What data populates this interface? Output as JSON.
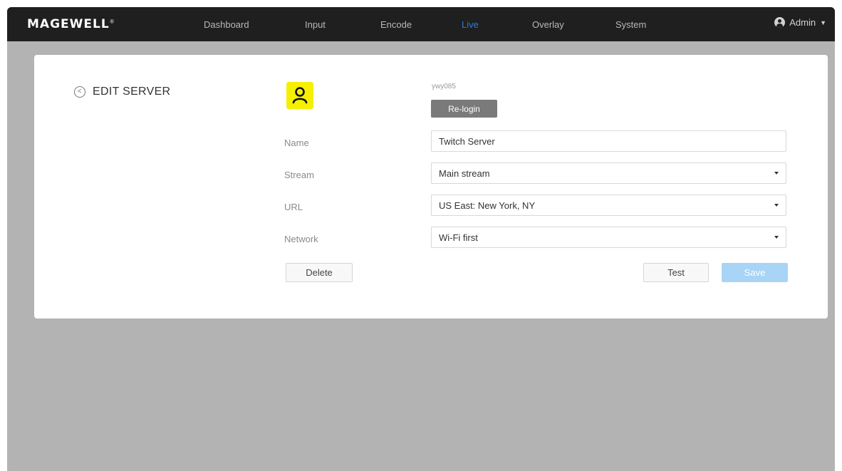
{
  "brand": {
    "logo_text": "MAGEWELL",
    "trademark": "®"
  },
  "nav": {
    "items": [
      {
        "label": "Dashboard",
        "active": false
      },
      {
        "label": "Input",
        "active": false
      },
      {
        "label": "Encode",
        "active": false
      },
      {
        "label": "Live",
        "active": true
      },
      {
        "label": "Overlay",
        "active": false
      },
      {
        "label": "System",
        "active": false
      }
    ],
    "user": {
      "label": "Admin",
      "icon": "user-icon"
    }
  },
  "page": {
    "title": "EDIT SERVER",
    "back_icon": "back-arrow-icon"
  },
  "account": {
    "avatar_icon": "user-avatar-icon",
    "avatar_color": "#f5f000",
    "username": "ywy085",
    "relogin_label": "Re-login"
  },
  "form": {
    "name": {
      "label": "Name",
      "value": "Twitch Server"
    },
    "stream": {
      "label": "Stream",
      "value": "Main stream"
    },
    "url": {
      "label": "URL",
      "value": "US East: New York, NY"
    },
    "network": {
      "label": "Network",
      "value": "Wi-Fi first"
    }
  },
  "actions": {
    "delete_label": "Delete",
    "test_label": "Test",
    "save_label": "Save"
  },
  "colors": {
    "accent": "#2e7bd6",
    "topbar": "#1f1f1f",
    "background": "#b3b3b3",
    "save_disabled": "#a8d4f5"
  }
}
